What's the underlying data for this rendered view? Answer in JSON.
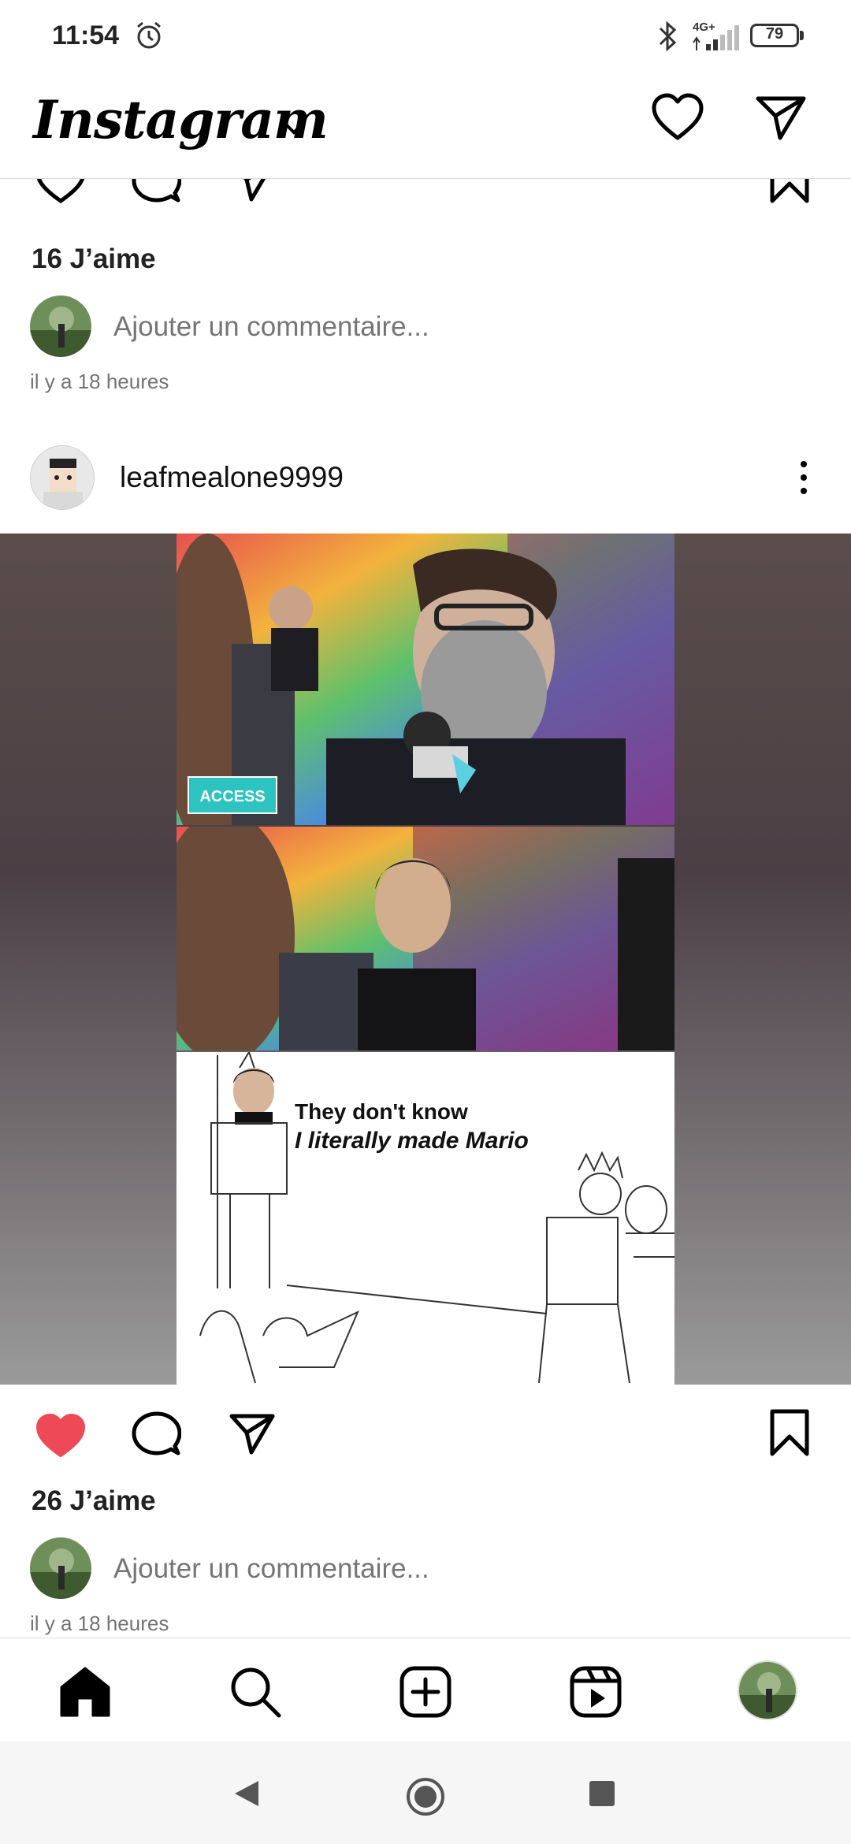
{
  "status_bar": {
    "time": "11:54",
    "network_label": "4G+",
    "battery": "79"
  },
  "header": {
    "app_title": "Instagram",
    "dropdown_icon": "chevron-down-icon",
    "notifications_icon": "heart-outline-icon",
    "messages_icon": "send-icon"
  },
  "previous_post": {
    "likes": "16 J’aime",
    "comment_placeholder": "Ajouter un commentaire...",
    "timestamp": "il y a 18 heures",
    "liked": false
  },
  "post": {
    "username": "leafmealone9999",
    "media": {
      "meme_caption_line1": "They don't know",
      "meme_caption_line2": "I literally made Mario",
      "badge_text": "ACCESS"
    },
    "liked": true,
    "like_color": "#ed4956",
    "likes": "26 J’aime",
    "comment_placeholder": "Ajouter un commentaire...",
    "timestamp": "il y a 18 heures"
  },
  "bottom_nav": {
    "items": [
      "home-icon",
      "search-icon",
      "create-icon",
      "reels-icon",
      "profile-avatar"
    ],
    "active": "home-icon"
  },
  "system_nav": {
    "items": [
      "back-icon",
      "home-circle-icon",
      "recents-icon"
    ]
  }
}
